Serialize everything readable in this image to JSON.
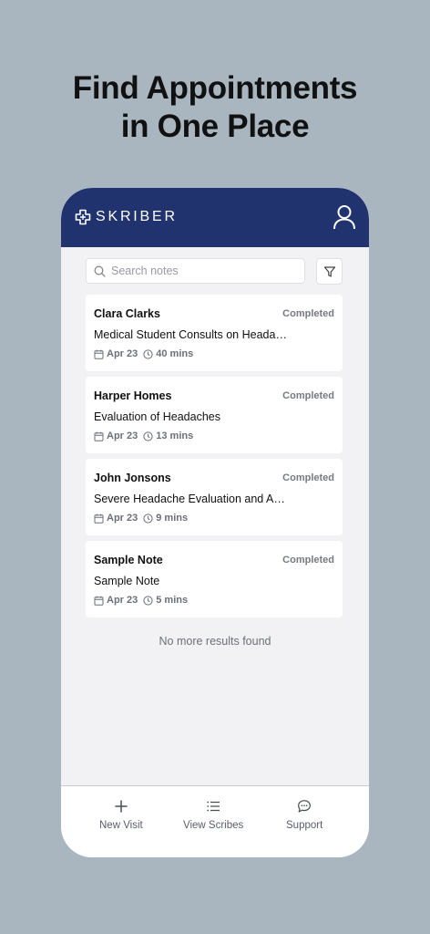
{
  "promo": {
    "headline_line1": "Find Appointments",
    "headline_line2": "in One Place"
  },
  "app": {
    "brand": "SKRIBER",
    "colors": {
      "appbar": "#20336f",
      "background": "#f2f2f5",
      "page": "#a9b6bf"
    },
    "icons": {
      "logo": "medical-cross-icon",
      "profile": "user-icon",
      "search": "search-icon",
      "filter": "filter-icon"
    }
  },
  "search": {
    "placeholder": "Search notes",
    "value": ""
  },
  "notes": [
    {
      "patient": "Clara Clarks",
      "status": "Completed",
      "title": "Medical Student Consults on Headac...",
      "date": "Apr 23",
      "duration": "40 mins"
    },
    {
      "patient": "Harper Homes",
      "status": "Completed",
      "title": "Evaluation of Headaches",
      "date": "Apr 23",
      "duration": "13 mins"
    },
    {
      "patient": "John Jonsons",
      "status": "Completed",
      "title": "Severe Headache Evaluation and Ass...",
      "date": "Apr 23",
      "duration": "9 mins"
    },
    {
      "patient": "Sample Note",
      "status": "Completed",
      "title": "Sample Note",
      "date": "Apr 23",
      "duration": "5 mins"
    }
  ],
  "list_end_text": "No more results found",
  "bottom_nav": [
    {
      "label": "New Visit",
      "icon": "plus-icon"
    },
    {
      "label": "View Scribes",
      "icon": "list-icon"
    },
    {
      "label": "Support",
      "icon": "chat-bubble-icon"
    }
  ]
}
